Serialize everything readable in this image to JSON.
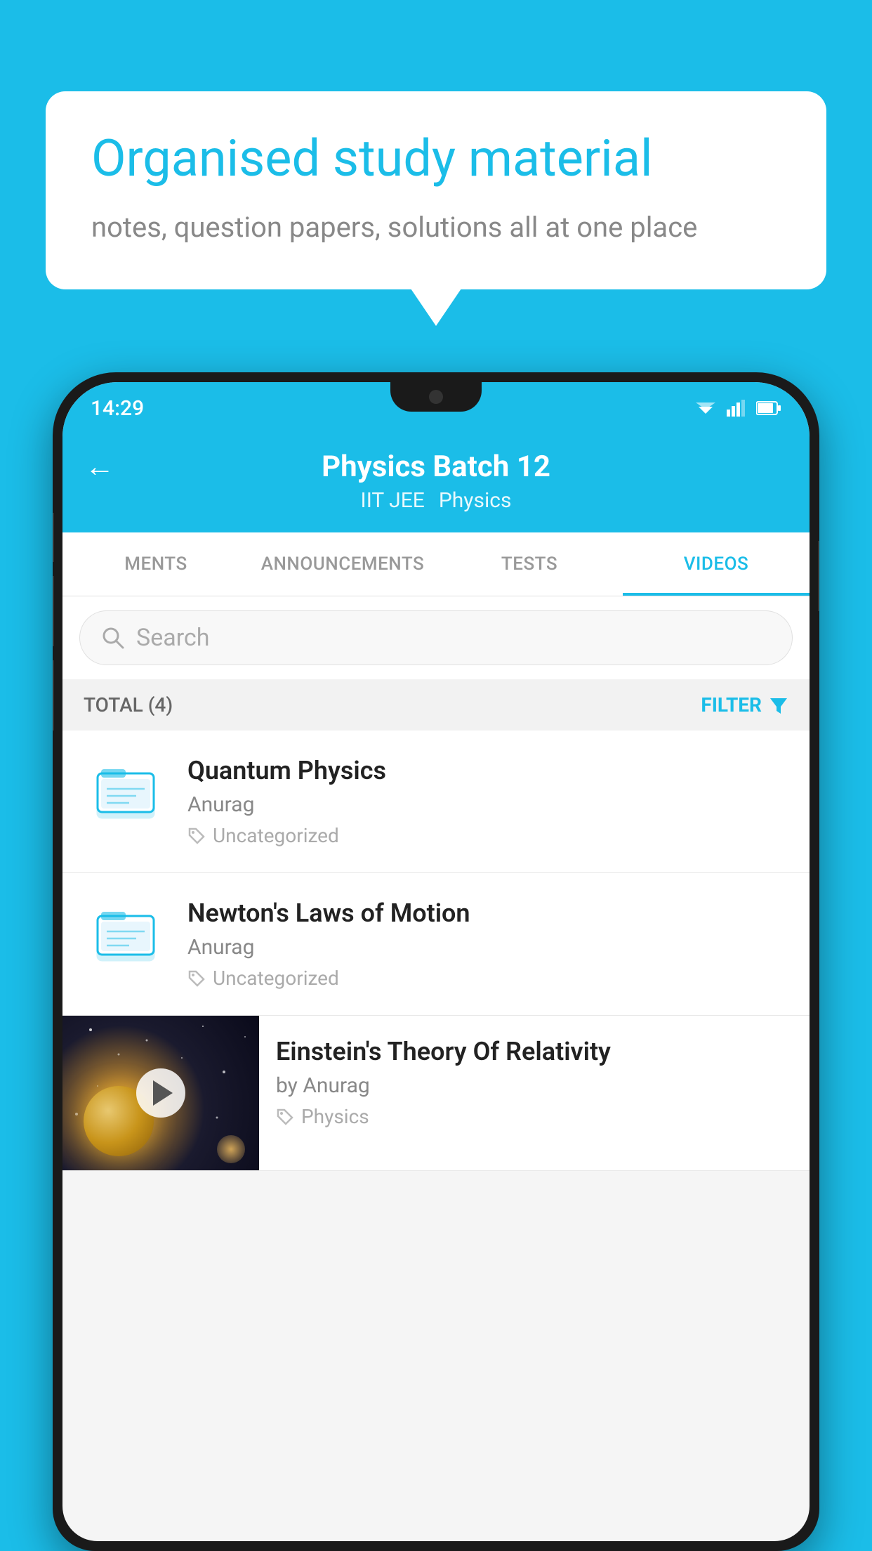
{
  "background_color": "#1bbde8",
  "bubble": {
    "title": "Organised study material",
    "subtitle": "notes, question papers, solutions all at one place"
  },
  "phone": {
    "status_bar": {
      "time": "14:29",
      "icons": [
        "wifi",
        "signal",
        "battery"
      ]
    },
    "header": {
      "title": "Physics Batch 12",
      "subtitle1": "IIT JEE",
      "subtitle2": "Physics",
      "back_label": "←"
    },
    "tabs": [
      {
        "label": "MENTS",
        "active": false
      },
      {
        "label": "ANNOUNCEMENTS",
        "active": false
      },
      {
        "label": "TESTS",
        "active": false
      },
      {
        "label": "VIDEOS",
        "active": true
      }
    ],
    "search": {
      "placeholder": "Search"
    },
    "filter": {
      "total_label": "TOTAL (4)",
      "filter_label": "FILTER"
    },
    "videos": [
      {
        "title": "Quantum Physics",
        "author": "Anurag",
        "tag": "Uncategorized",
        "has_thumb": false
      },
      {
        "title": "Newton's Laws of Motion",
        "author": "Anurag",
        "tag": "Uncategorized",
        "has_thumb": false
      },
      {
        "title": "Einstein's Theory Of Relativity",
        "author": "by Anurag",
        "tag": "Physics",
        "has_thumb": true
      }
    ]
  }
}
